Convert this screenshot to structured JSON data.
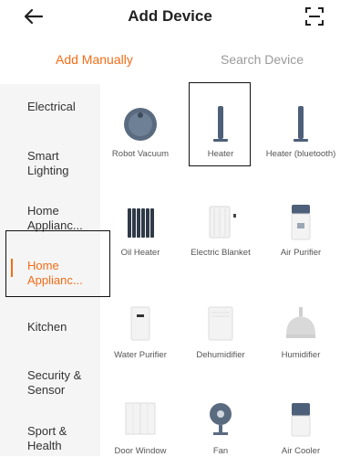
{
  "header": {
    "title": "Add Device",
    "back_icon": "back-arrow-icon",
    "scan_icon": "scan-icon"
  },
  "tabs": {
    "manual": "Add Manually",
    "search": "Search Device"
  },
  "sidebar": {
    "items": [
      {
        "label": "Electrical"
      },
      {
        "label": "Smart Lighting"
      },
      {
        "label": "Home Applianc..."
      },
      {
        "label": "Home Applianc..."
      },
      {
        "label": "Kitchen"
      },
      {
        "label": "Security & Sensor"
      },
      {
        "label": "Sport & Health"
      }
    ]
  },
  "devices": [
    {
      "label": "Robot Vacuum",
      "icon": "robot-vacuum-icon"
    },
    {
      "label": "Heater",
      "icon": "heater-icon"
    },
    {
      "label": "Heater (bluetooth)",
      "icon": "heater-bluetooth-icon"
    },
    {
      "label": "Oil Heater",
      "icon": "oil-heater-icon"
    },
    {
      "label": "Electric Blanket",
      "icon": "electric-blanket-icon"
    },
    {
      "label": "Air Purifier",
      "icon": "air-purifier-icon"
    },
    {
      "label": "Water Purifier",
      "icon": "water-purifier-icon"
    },
    {
      "label": "Dehumidifier",
      "icon": "dehumidifier-icon"
    },
    {
      "label": "Humidifier",
      "icon": "humidifier-icon"
    },
    {
      "label": "Door Window",
      "icon": "door-window-icon"
    },
    {
      "label": "Fan",
      "icon": "fan-icon"
    },
    {
      "label": "Air Cooler",
      "icon": "air-cooler-icon"
    }
  ],
  "colors": {
    "accent": "#f56c16",
    "sidebar_bg": "#f5f5f5",
    "device_grey": "#5a6b80"
  }
}
